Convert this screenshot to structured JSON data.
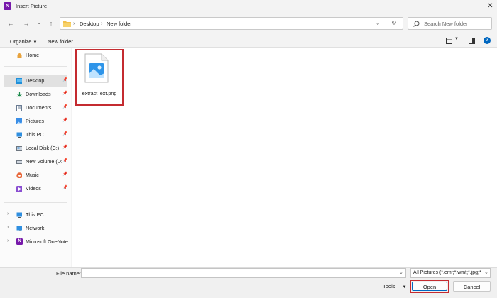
{
  "window": {
    "title": "Insert Picture",
    "app_icon_letter": "N"
  },
  "nav": {
    "breadcrumb": [
      "Desktop",
      "New folder"
    ],
    "search_placeholder": "Search New folder"
  },
  "toolbar": {
    "organize_label": "Organize",
    "new_folder_label": "New folder"
  },
  "sidebar": {
    "home": "Home",
    "quick_access": [
      {
        "label": "Desktop",
        "icon": "desktop-icon",
        "selected": true
      },
      {
        "label": "Downloads",
        "icon": "download-icon"
      },
      {
        "label": "Documents",
        "icon": "document-icon"
      },
      {
        "label": "Pictures",
        "icon": "picture-icon"
      },
      {
        "label": "This PC",
        "icon": "computer-icon"
      },
      {
        "label": "Local Disk (C:)",
        "icon": "disk-icon"
      },
      {
        "label": "New Volume (D:",
        "icon": "drive-icon"
      },
      {
        "label": "Music",
        "icon": "music-icon"
      },
      {
        "label": "Videos",
        "icon": "video-icon"
      }
    ],
    "tree": [
      {
        "label": "This PC",
        "icon": "computer-icon"
      },
      {
        "label": "Network",
        "icon": "network-icon"
      },
      {
        "label": "Microsoft OneNote",
        "icon": "onenote-icon"
      }
    ]
  },
  "files": [
    {
      "name": "extractText.png",
      "icon": "image-file-icon"
    }
  ],
  "footer": {
    "file_name_label": "File name:",
    "file_name_value": "",
    "filter_value": "All Pictures (*.emf;*.wmf;*.jpg;*",
    "tools_label": "Tools",
    "open_label": "Open",
    "cancel_label": "Cancel"
  },
  "colors": {
    "highlight_red": "#c42b30",
    "folder_yellow": "#f2c14e",
    "accent_blue": "#0067c0"
  }
}
